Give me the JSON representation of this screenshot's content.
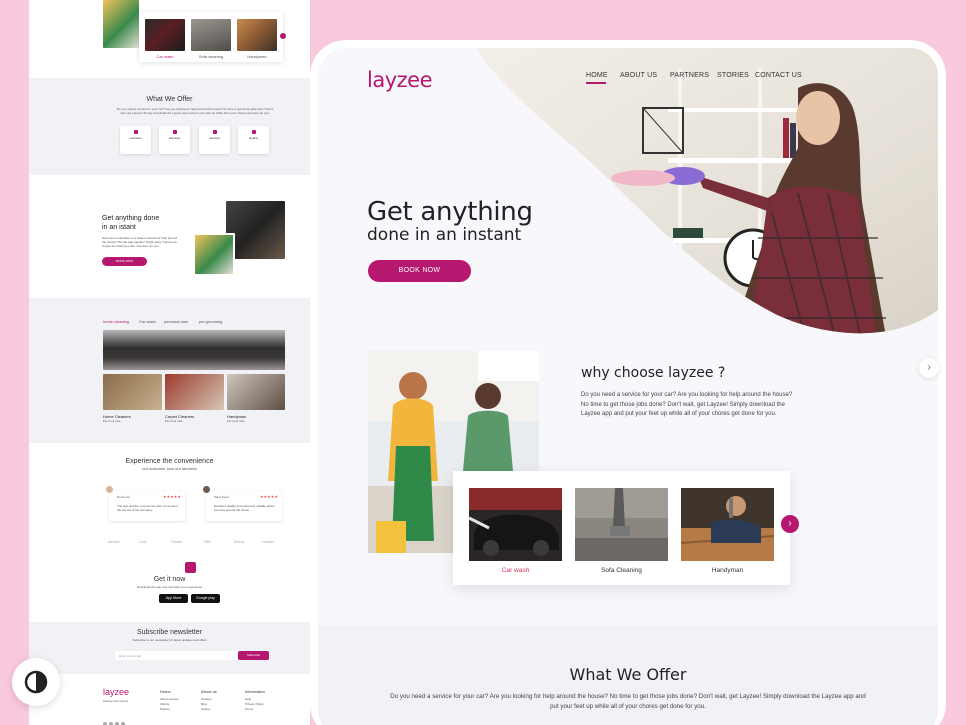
{
  "left_page": {
    "top_services": [
      "Car wash",
      "Sofa cleaning",
      "Handyman"
    ],
    "what_we_offer": {
      "title": "What We Offer",
      "text": "Do you need a service for your car? Are you looking for help around the house? No time to get those jobs done? Don't wait, get Layzee! Simply download the Layzee app and put your feet up while all of your chores get done for you.",
      "cards": [
        "Launders",
        "Services",
        "Vendors",
        "Quality"
      ]
    },
    "get_done": {
      "title_line1": "Get anything done",
      "title_line2": "in an istant",
      "text": "Someone could take on a Space scarred for help around the house? Put the app together. Right away it will be as simple as ordering a ride. Get done for you.",
      "button": "BOOK NOW"
    },
    "categories": [
      "home cleaning",
      "Car wash",
      "personal care",
      "pet grooming"
    ],
    "gallery_labels": [
      "Home Cleaners",
      "Carpet Cleaners",
      "Handyman"
    ],
    "gallery_sub": "Per hour rate",
    "experience": {
      "title": "Experience the convenience",
      "subtitle": "our customer love our services"
    },
    "reviews": [
      {
        "name": "Nora Leis",
        "stars": "★★★★★",
        "text": "The app and the cool service with vet as all of the chores of the company"
      },
      {
        "name": "Pana Kova",
        "stars": "★★★★★",
        "text": "Excellent quality and extremely reliable all the services around the house"
      }
    ],
    "partner_logos": [
      "Ainslie",
      "Cult",
      "Studio",
      "RBL",
      "Mona",
      "Ladder"
    ],
    "get_it_now": {
      "title": "Get it now",
      "subtitle": "Download the app now and start your experience",
      "app_store": "App Store",
      "google_play": "Google play"
    },
    "newsletter": {
      "title": "Subscribe newsletter",
      "subtitle": "Subscribe to our newsletter for latest updates and offers",
      "placeholder": "Enter your email",
      "button": "Subscribe"
    },
    "footer": {
      "logo": "layzee",
      "tagline": "Layzee Get it done",
      "columns": [
        {
          "title": "Home",
          "links": [
            "About Layzee",
            "Clients",
            "Partner"
          ]
        },
        {
          "title": "About us",
          "links": [
            "Careers",
            "Blog",
            "Stories"
          ]
        },
        {
          "title": "Information",
          "links": [
            "Help",
            "Privacy Policy",
            "Terms"
          ]
        }
      ]
    }
  },
  "right_page": {
    "brand": "layzee",
    "nav": [
      "HOME",
      "ABOUT US",
      "PARTNERS",
      "STORIES",
      "CONTACT US"
    ],
    "active_nav": "HOME",
    "hero": {
      "title": "Get anything",
      "subtitle": "done in an instant",
      "button": "BOOK NOW"
    },
    "why": {
      "title": "why choose layzee ?",
      "text": "Do you need a service for your car? Are you looking for help around the house? No time to get those jobs done? Don't wait, get Layzee! Simply download the Layzee app and put your feet up while all of your chores get done for you."
    },
    "services": [
      {
        "label": "Car wash",
        "active": true
      },
      {
        "label": "Sofa Cleaning",
        "active": false
      },
      {
        "label": "Handyman",
        "active": false
      }
    ],
    "offer": {
      "title": "What We Offer",
      "text": "Do you need a service for your car? Are you looking for help around the house? No time to get those jobs done? Don't wait, get Layzee! Simply download the Layzee app and put your feet up while all of your chores get done for you."
    }
  },
  "colors": {
    "accent": "#b5186e",
    "background": "#f9c9dd",
    "panel": "#f1f2f6"
  },
  "icons": [
    "chevron-right-icon",
    "theme-toggle-icon",
    "star-icon",
    "apple-icon",
    "play-icon"
  ]
}
